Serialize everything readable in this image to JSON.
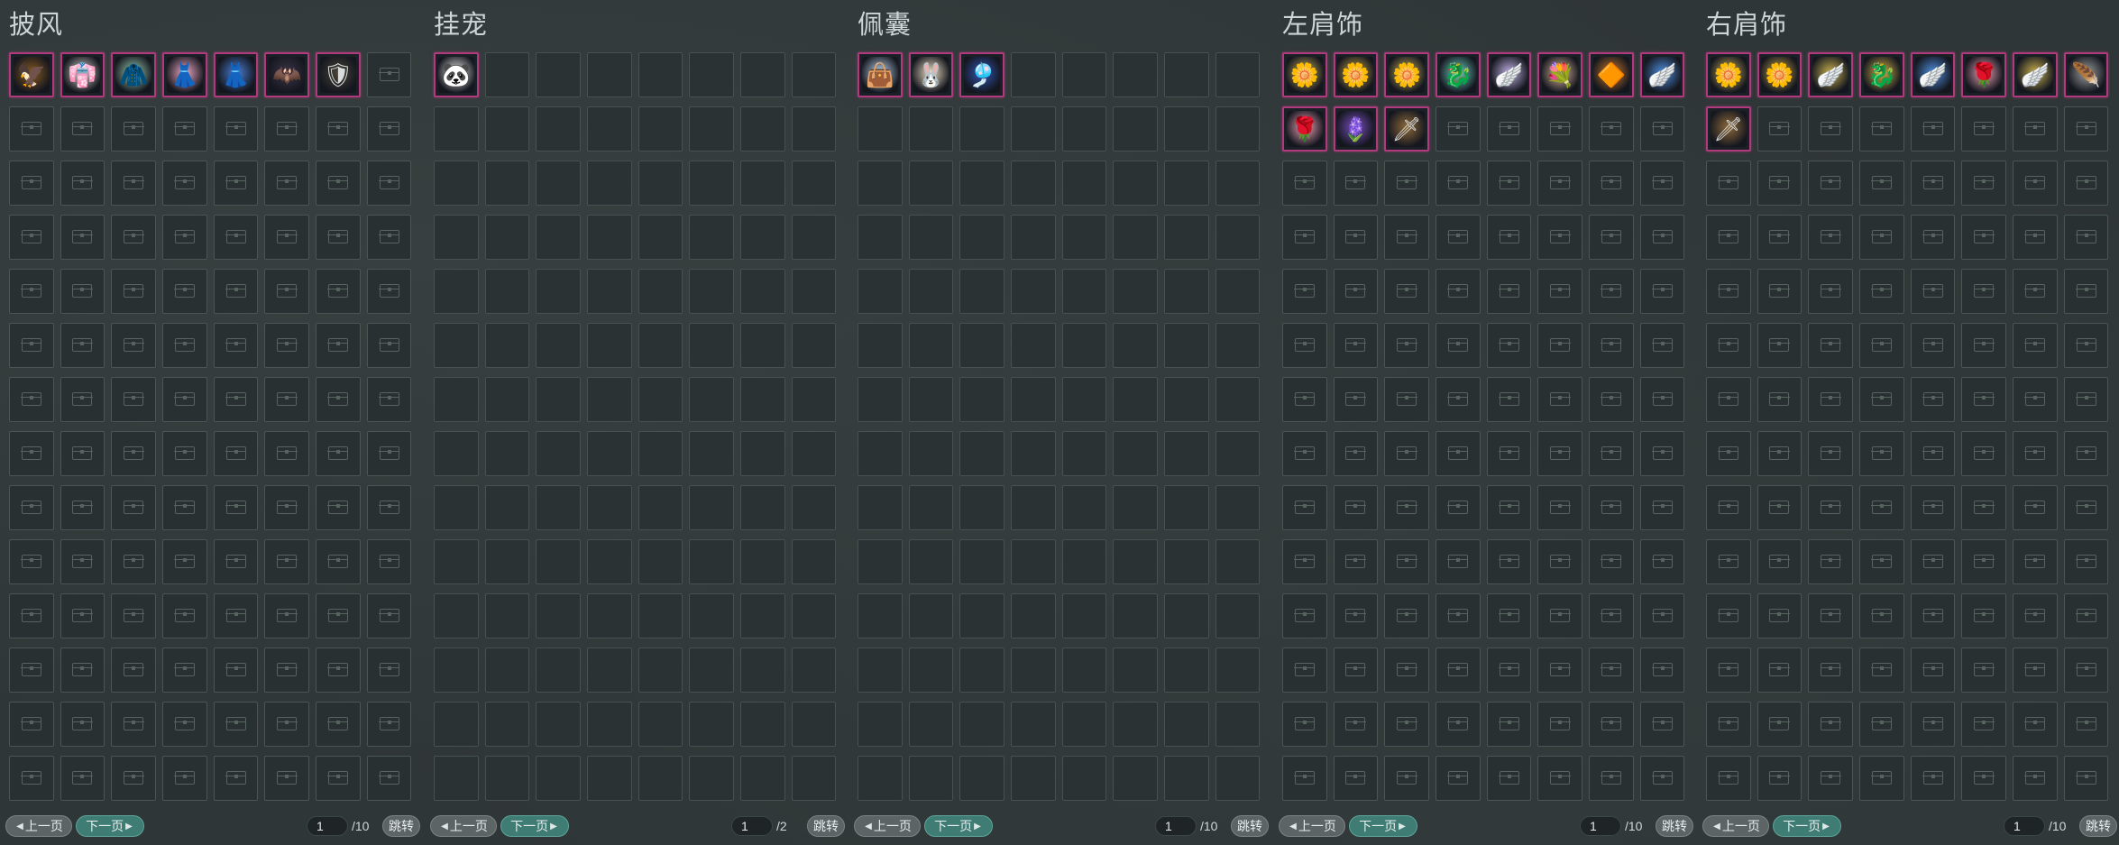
{
  "colors": {
    "item_border": "#b03a7e",
    "next_button": "#3e7c74",
    "prev_button": "#5d6465"
  },
  "pager_labels": {
    "prev": "上一页",
    "next": "下一页",
    "jump": "跳转"
  },
  "panels": [
    {
      "title": "披风",
      "slot_style": "chest",
      "page": {
        "current": "1",
        "total": "/10"
      },
      "items": [
        {
          "icon": "cape-gold-icon",
          "glyph": "🦅",
          "color": "#8a5a20"
        },
        {
          "icon": "cape-white-icon",
          "glyph": "👘",
          "color": "#d9d4cc"
        },
        {
          "icon": "cape-green-icon",
          "glyph": "🧥",
          "color": "#9fd2b5"
        },
        {
          "icon": "cape-pink-icon",
          "glyph": "👗",
          "color": "#f0a9c6"
        },
        {
          "icon": "cape-blue-icon",
          "glyph": "👗",
          "color": "#4b7fd6"
        },
        {
          "icon": "cape-dark-wing-icon",
          "glyph": "🦇",
          "color": "#3b3448"
        },
        {
          "icon": "cape-armor-icon",
          "glyph": "🛡",
          "color": "#4a4438"
        }
      ]
    },
    {
      "title": "挂宠",
      "slot_style": "plain",
      "page": {
        "current": "1",
        "total": "/2"
      },
      "items": [
        {
          "icon": "pet-panda-icon",
          "glyph": "🐼",
          "color": "#e8e8e8"
        }
      ]
    },
    {
      "title": "佩囊",
      "slot_style": "plain",
      "page": {
        "current": "1",
        "total": "/10"
      },
      "items": [
        {
          "icon": "pouch-white-icon",
          "glyph": "👜",
          "color": "#bcd6ee"
        },
        {
          "icon": "pouch-rabbit-icon",
          "glyph": "🐰",
          "color": "#f3e2c4"
        },
        {
          "icon": "pouch-blue-icon",
          "glyph": "🎐",
          "color": "#3357b8"
        }
      ]
    },
    {
      "title": "左肩饰",
      "slot_style": "chest",
      "page": {
        "current": "1",
        "total": "/10"
      },
      "items": [
        {
          "icon": "shoulder-gold-flower-icon",
          "glyph": "🌼",
          "color": "#c9b25a"
        },
        {
          "icon": "shoulder-gold-blue-icon",
          "glyph": "🌼",
          "color": "#c6a84a"
        },
        {
          "icon": "shoulder-gold-flower-icon",
          "glyph": "🌼",
          "color": "#c9b25a"
        },
        {
          "icon": "shoulder-teal-icon",
          "glyph": "🐉",
          "color": "#6fd4c2"
        },
        {
          "icon": "shoulder-lilac-icon",
          "glyph": "🪽",
          "color": "#c3b2e6"
        },
        {
          "icon": "shoulder-bouquet-icon",
          "glyph": "💐",
          "color": "#e0b9a0"
        },
        {
          "icon": "shoulder-orange-ring-icon",
          "glyph": "🔶",
          "color": "#d07a2a"
        },
        {
          "icon": "shoulder-blue-wing-icon",
          "glyph": "🪽",
          "color": "#4f8fe0"
        },
        {
          "icon": "shoulder-rose-icon",
          "glyph": "🌹",
          "color": "#f1a3b8"
        },
        {
          "icon": "shoulder-purple-icon",
          "glyph": "🪻",
          "color": "#7a4fc2"
        },
        {
          "icon": "shoulder-bronze-icon",
          "glyph": "🗡",
          "color": "#8f6a3a"
        }
      ]
    },
    {
      "title": "右肩饰",
      "slot_style": "chest",
      "page": {
        "current": "1",
        "total": "/10"
      },
      "items": [
        {
          "icon": "shoulder-gold-flower-icon",
          "glyph": "🌼",
          "color": "#c9b25a"
        },
        {
          "icon": "shoulder-gold-blue-icon",
          "glyph": "🌼",
          "color": "#c6a84a"
        },
        {
          "icon": "shoulder-gold-wing-icon",
          "glyph": "🪽",
          "color": "#cbb24f"
        },
        {
          "icon": "shoulder-gold-dragon-icon",
          "glyph": "🐉",
          "color": "#d3b44a"
        },
        {
          "icon": "shoulder-blue-wing-icon",
          "glyph": "🪽",
          "color": "#4f8fe0"
        },
        {
          "icon": "shoulder-rose-icon",
          "glyph": "🌹",
          "color": "#f1a3b8"
        },
        {
          "icon": "shoulder-gold-wing-icon",
          "glyph": "🪽",
          "color": "#cbb24f"
        },
        {
          "icon": "shoulder-silver-icon",
          "glyph": "🪶",
          "color": "#9da0a0"
        },
        {
          "icon": "shoulder-bronze-icon",
          "glyph": "🗡",
          "color": "#8f6a3a"
        }
      ]
    }
  ]
}
